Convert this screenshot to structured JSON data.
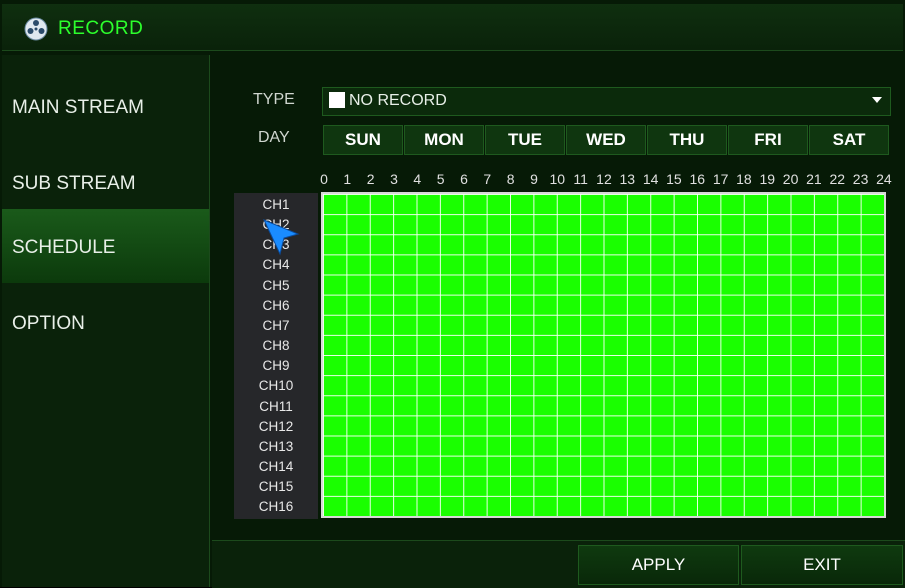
{
  "window": {
    "title": "RECORD",
    "title_icon": "film-reel-icon"
  },
  "sidebar": {
    "items": [
      {
        "label": "MAIN STREAM",
        "active": false
      },
      {
        "label": "SUB STREAM",
        "active": false
      },
      {
        "label": "SCHEDULE",
        "active": true
      },
      {
        "label": "OPTION",
        "active": false
      }
    ]
  },
  "schedule": {
    "type_label": "TYPE",
    "type_value": "NO RECORD",
    "type_swatch_color": "#ffffff",
    "day_label": "DAY",
    "days": [
      "SUN",
      "MON",
      "TUE",
      "WED",
      "THU",
      "FRI",
      "SAT"
    ],
    "hours": [
      "0",
      "1",
      "2",
      "3",
      "4",
      "5",
      "6",
      "7",
      "8",
      "9",
      "10",
      "11",
      "12",
      "13",
      "14",
      "15",
      "16",
      "17",
      "18",
      "19",
      "20",
      "21",
      "22",
      "23",
      "24"
    ],
    "channels": [
      "CH1",
      "CH2",
      "CH3",
      "CH4",
      "CH5",
      "CH6",
      "CH7",
      "CH8",
      "CH9",
      "CH10",
      "CH11",
      "CH12",
      "CH13",
      "CH14",
      "CH15",
      "CH16"
    ],
    "grid_color": "#1aff00"
  },
  "footer": {
    "apply_label": "APPLY",
    "exit_label": "EXIT"
  },
  "colors": {
    "accent": "#2cff2c",
    "background": "#061a06",
    "active_item": "#1a5a1a"
  }
}
